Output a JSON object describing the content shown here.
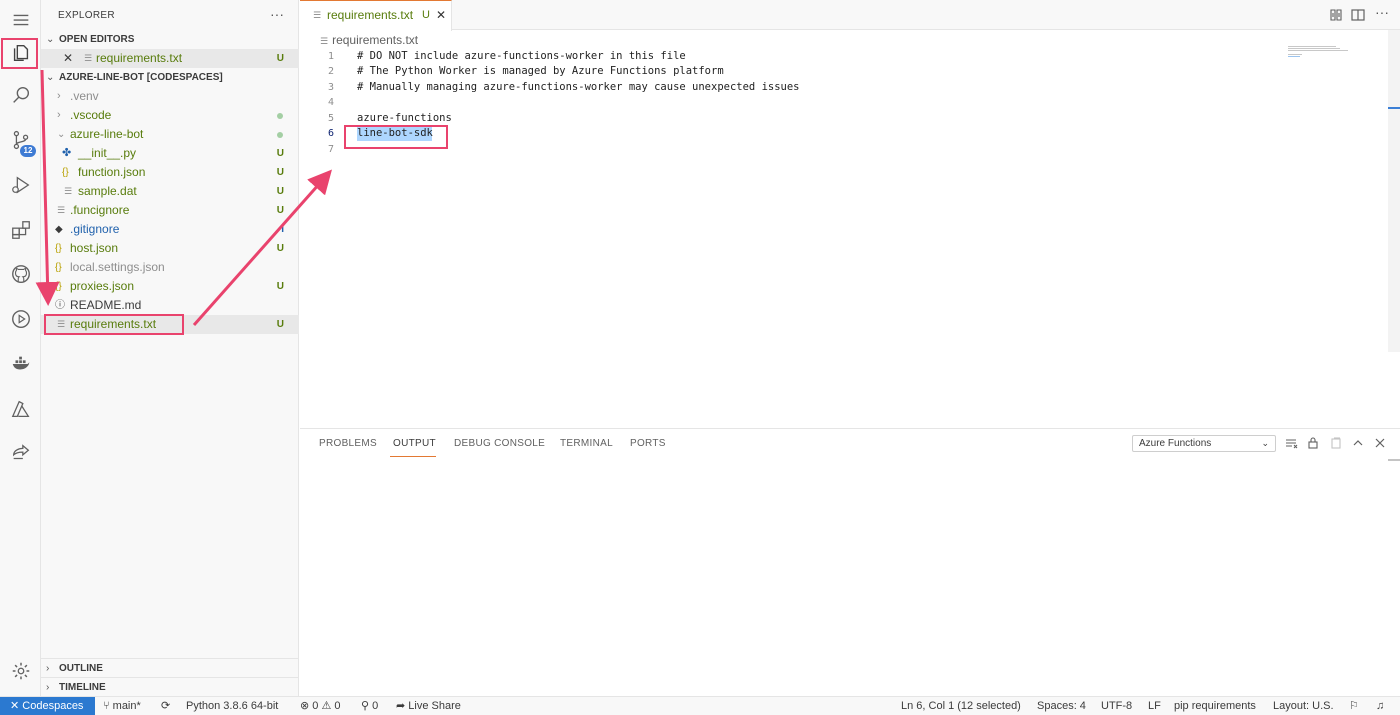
{
  "sidebar": {
    "title": "EXPLORER",
    "more": "···",
    "open_editors": {
      "header": "OPEN EDITORS",
      "items": [
        {
          "name": "requirements.txt",
          "status": "U"
        }
      ]
    },
    "project": {
      "header": "AZURE-LINE-BOT [CODESPACES]",
      "items": [
        {
          "name": ".venv",
          "status": "",
          "kind": "folder"
        },
        {
          "name": ".vscode",
          "status": "dot",
          "kind": "folder"
        },
        {
          "name": "azure-line-bot",
          "status": "dot",
          "kind": "folder"
        },
        {
          "name": "__init__.py",
          "status": "U",
          "kind": "python"
        },
        {
          "name": "function.json",
          "status": "U",
          "kind": "json"
        },
        {
          "name": "sample.dat",
          "status": "U",
          "kind": "file"
        },
        {
          "name": ".funcignore",
          "status": "U",
          "kind": "file"
        },
        {
          "name": ".gitignore",
          "status": "I",
          "kind": "git"
        },
        {
          "name": "host.json",
          "status": "U",
          "kind": "json"
        },
        {
          "name": "local.settings.json",
          "status": "",
          "kind": "json"
        },
        {
          "name": "proxies.json",
          "status": "U",
          "kind": "json"
        },
        {
          "name": "README.md",
          "status": "",
          "kind": "info"
        },
        {
          "name": "requirements.txt",
          "status": "U",
          "kind": "file"
        }
      ]
    },
    "outline": "OUTLINE",
    "timeline": "TIMELINE"
  },
  "activity": {
    "scm_badge": "12"
  },
  "editor": {
    "tab_label": "requirements.txt",
    "tab_status": "U",
    "tab_close": "✕",
    "breadcrumb": "requirements.txt",
    "lines": [
      "# DO NOT include azure-functions-worker in this file",
      "# The Python Worker is managed by Azure Functions platform",
      "# Manually managing azure-functions-worker may cause unexpected issues",
      "",
      "azure-functions",
      "line-bot-sdk",
      ""
    ],
    "line_numbers": [
      "1",
      "2",
      "3",
      "4",
      "5",
      "6",
      "7"
    ]
  },
  "panel": {
    "tabs": [
      "PROBLEMS",
      "OUTPUT",
      "DEBUG CONSOLE",
      "TERMINAL",
      "PORTS"
    ],
    "active_tab": "OUTPUT",
    "output_channel": "Azure Functions"
  },
  "statusbar": {
    "remote": "Codespaces",
    "branch": "main*",
    "python": "Python 3.8.6 64-bit",
    "errors": "0",
    "warnings": "0",
    "ports": "0",
    "live_share": "Live Share",
    "cursor": "Ln 6, Col 1 (12 selected)",
    "spaces": "Spaces: 4",
    "encoding": "UTF-8",
    "eol": "LF",
    "language": "pip requirements",
    "layout": "Layout: U.S."
  },
  "colors": {
    "accent": "#2b79d0",
    "untracked": "#587c0c",
    "annotation": "#e9436d",
    "active_tab_border": "#e37933"
  }
}
